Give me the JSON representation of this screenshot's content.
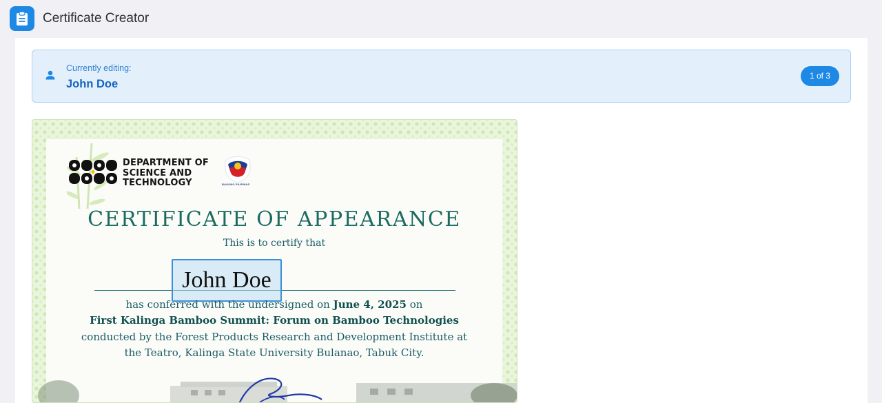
{
  "app": {
    "title": "Certificate Creator",
    "icon": "clipboard-icon",
    "accent": "#1e88e5"
  },
  "editing": {
    "label": "Currently editing:",
    "name": "John Doe",
    "position": "1 of 3",
    "icon": "person-icon"
  },
  "certificate": {
    "org_lines": [
      "DEPARTMENT OF",
      "SCIENCE AND",
      "TECHNOLOGY"
    ],
    "bp_caption": "BAGONG PILIPINAS",
    "title": "CERTIFICATE OF APPEARANCE",
    "certify": "This is to certify that",
    "recipient": "John Doe",
    "line1_pre": "has conferred with the undersigned on",
    "date": "June 4, 2025",
    "line1_post": "on",
    "event": "First Kalinga Bamboo Summit: Forum on Bamboo Technologies",
    "line3": "conducted by the Forest Products Research and Development Institute at",
    "line4": "the Teatro, Kalinga State University Bulanao, Tabuk City.",
    "colors": {
      "title": "#1b6b62",
      "body": "#1a5a66",
      "border": "#e9f5dc",
      "highlight": "#3a8fd8"
    }
  }
}
